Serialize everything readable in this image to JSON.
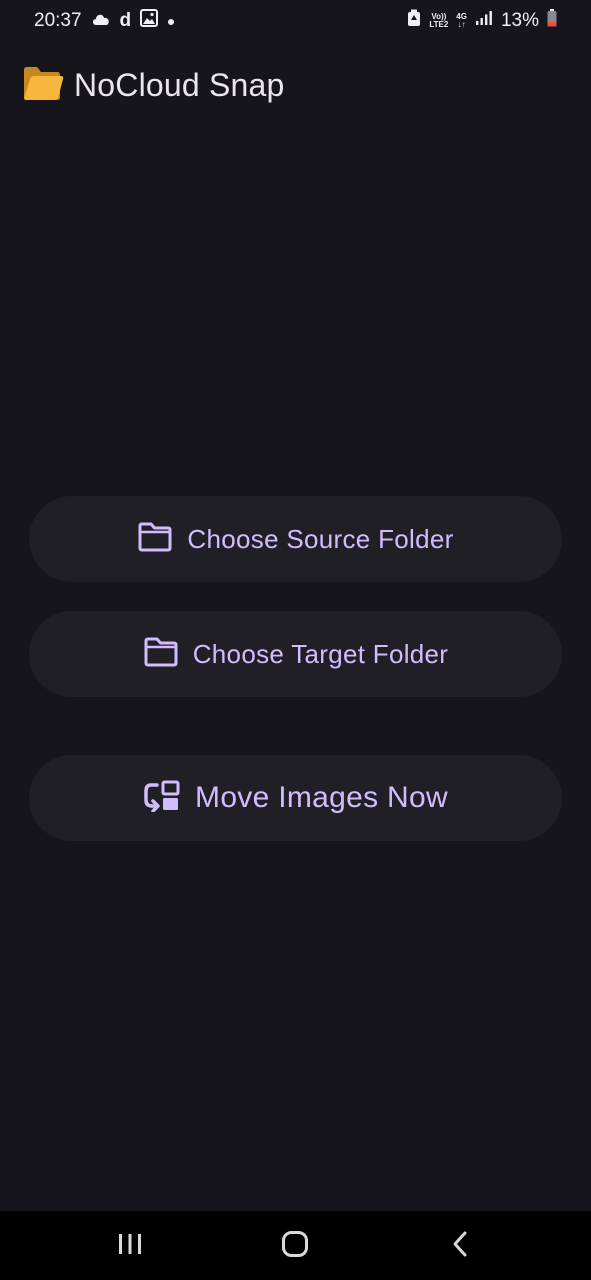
{
  "status_bar": {
    "time": "20:37",
    "carrier_letter": "d",
    "volte_line1": "Vo))",
    "volte_line2": "LTE2",
    "network_type": "4G",
    "battery_percent": "13%"
  },
  "header": {
    "icon": "folder-emoji-icon",
    "title": "NoCloud Snap"
  },
  "actions": {
    "choose_source": "Choose Source Folder",
    "choose_target": "Choose Target Folder",
    "move_images": "Move Images Now"
  },
  "colors": {
    "background": "#17151c",
    "button_bg": "#211f26",
    "accent": "#d1bcff"
  }
}
